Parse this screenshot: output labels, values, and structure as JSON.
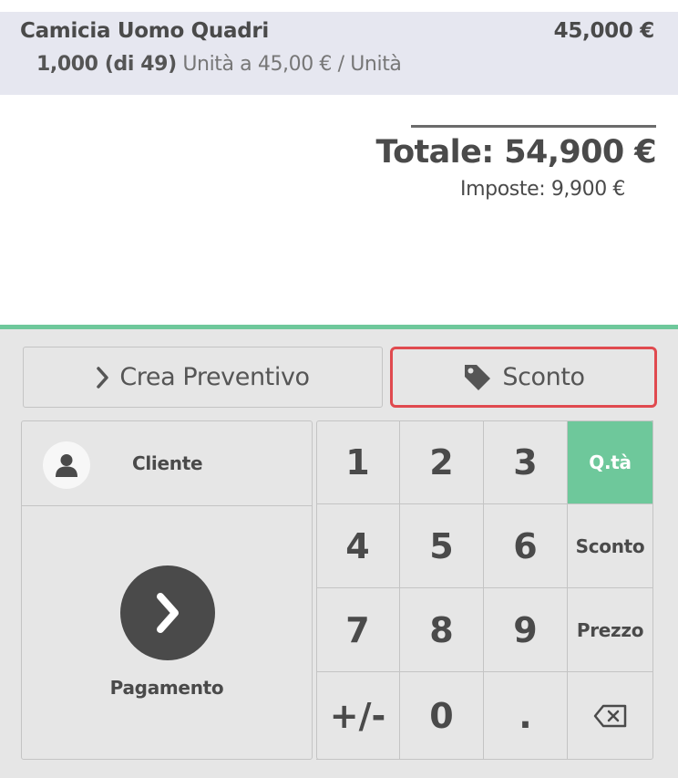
{
  "orderline": {
    "product_name": "Camicia Uomo Quadri",
    "price": "45,000 €",
    "quantity": "1,000 (di 49)",
    "unit_info": "Unità a 45,00 € / Unità"
  },
  "summary": {
    "total": "Totale: 54,900 €",
    "taxes": "Imposte: 9,900 €"
  },
  "control_buttons": {
    "quote_label": "Crea Preventivo",
    "discount_label": "Sconto"
  },
  "actionpad": {
    "customer_label": "Cliente",
    "payment_label": "Pagamento"
  },
  "numpad": {
    "keys": [
      "1",
      "2",
      "3",
      "4",
      "5",
      "6",
      "7",
      "8",
      "9",
      "+/-",
      "0",
      "."
    ],
    "modes": [
      "Q.tà",
      "Sconto",
      "Prezzo"
    ],
    "active_mode": "Q.tà",
    "backspace_icon": "backspace-icon"
  },
  "colors": {
    "accent": "#6ec89b",
    "highlight_border": "#e04a4f",
    "orderline_bg": "#e6e7f0",
    "pad_bg": "#e6e6e6",
    "text": "#4a4a4a"
  }
}
